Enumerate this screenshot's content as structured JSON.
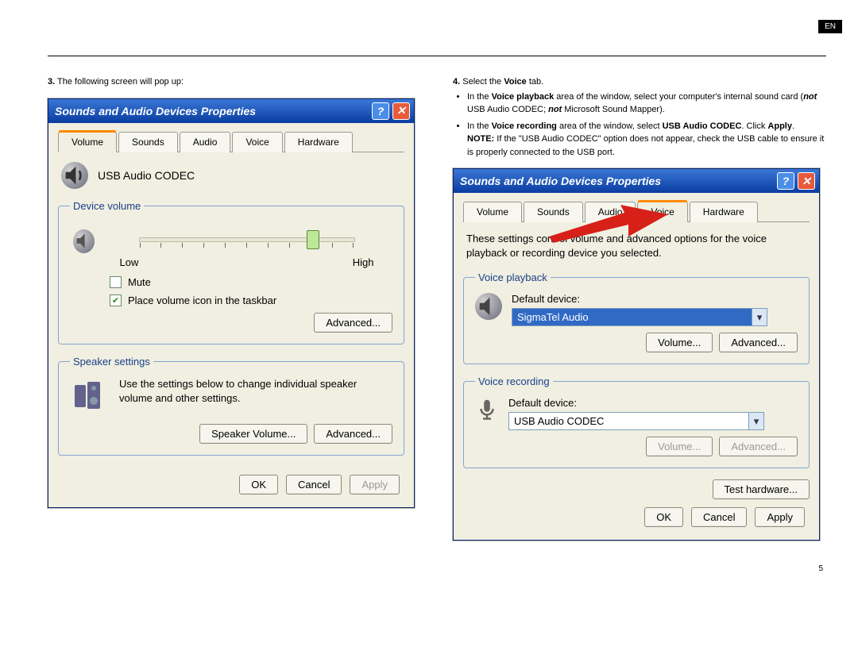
{
  "page": {
    "lang_tag": "EN",
    "page_number": "5"
  },
  "left": {
    "step_num": "3.",
    "step_text": "The following screen will pop up:",
    "window_title": "Sounds and Audio Devices Properties",
    "tabs": {
      "t0": "Volume",
      "t1": "Sounds",
      "t2": "Audio",
      "t3": "Voice",
      "t4": "Hardware"
    },
    "device_name": "USB Audio CODEC",
    "group_volume_legend": "Device volume",
    "slider": {
      "low": "Low",
      "high": "High"
    },
    "mute_label": "Mute",
    "tray_label": "Place volume icon in the taskbar",
    "btn_advanced": "Advanced...",
    "group_speaker_legend": "Speaker settings",
    "speaker_text": "Use the settings below to change individual speaker volume and other settings.",
    "btn_spk_vol": "Speaker Volume...",
    "btn_spk_adv": "Advanced...",
    "btn_ok": "OK",
    "btn_cancel": "Cancel",
    "btn_apply": "Apply"
  },
  "right": {
    "step_num": "4.",
    "step_text_intro": "Select the ",
    "step_text_voice": "Voice",
    "step_text_tab": " tab.",
    "bullet1_a": "In the ",
    "bullet1_b": "Voice playback",
    "bullet1_c": " area of the window, select your computer's internal sound card (",
    "bullet1_d": "not",
    "bullet1_e": " USB Audio CODEC; ",
    "bullet1_f": "not",
    "bullet1_g": " Microsoft Sound Mapper).",
    "bullet2_a": "In the ",
    "bullet2_b": "Voice recording",
    "bullet2_c": " area of the window, select ",
    "bullet2_d": "USB Audio CODEC",
    "bullet2_e": ". Click ",
    "bullet2_f": "Apply",
    "bullet2_g": ".",
    "note_a": "NOTE:",
    "note_b": " If the \"USB Audio CODEC\" option does not appear, check the USB cable to ensure it is properly connected to the USB port.",
    "window_title": "Sounds and Audio Devices Properties",
    "tabs": {
      "t0": "Volume",
      "t1": "Sounds",
      "t2": "Audio",
      "t3": "Voice",
      "t4": "Hardware"
    },
    "desc": "These settings control volume and advanced options for the voice playback or recording device you selected.",
    "grp_playback_legend": "Voice playback",
    "default_device": "Default device:",
    "playback_value": "SigmaTel Audio",
    "btn_pb_volume": "Volume...",
    "btn_pb_adv": "Advanced...",
    "grp_recording_legend": "Voice recording",
    "recording_value": "USB Audio CODEC",
    "btn_rec_volume": "Volume...",
    "btn_rec_adv": "Advanced...",
    "btn_test_hw": "Test hardware...",
    "btn_ok": "OK",
    "btn_cancel": "Cancel",
    "btn_apply": "Apply"
  }
}
